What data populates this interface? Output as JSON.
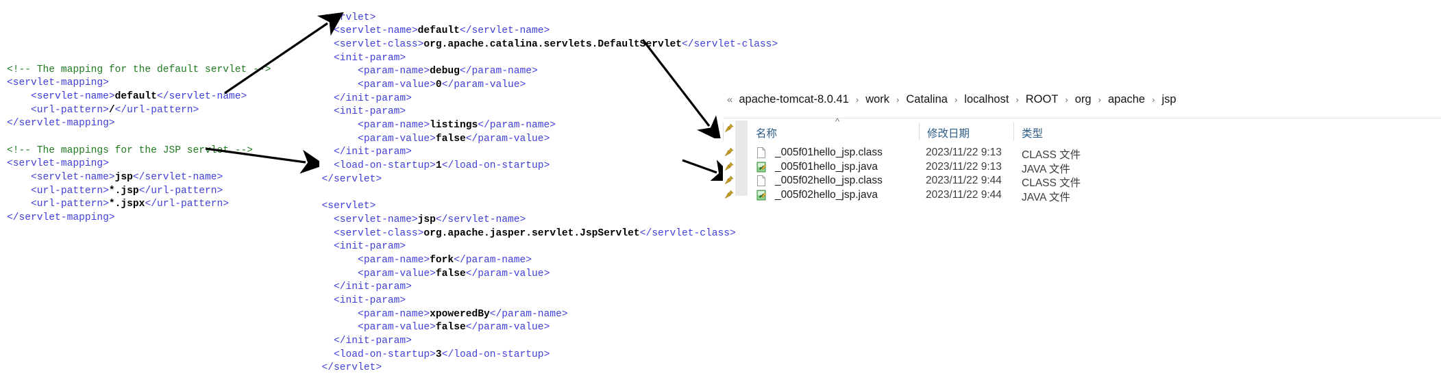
{
  "left_code": {
    "name": "web.xml servlet mappings",
    "lines": [
      [
        {
          "t": "cmt",
          "s": "<!-- The mapping for the default servlet -->"
        }
      ],
      [
        {
          "t": "tag",
          "s": "<servlet-mapping>"
        }
      ],
      [
        {
          "t": "tag",
          "s": "    <servlet-name>"
        },
        {
          "t": "val",
          "s": "default"
        },
        {
          "t": "tag",
          "s": "</servlet-name>"
        }
      ],
      [
        {
          "t": "tag",
          "s": "    <url-pattern>"
        },
        {
          "t": "val",
          "s": "/"
        },
        {
          "t": "tag",
          "s": "</url-pattern>"
        }
      ],
      [
        {
          "t": "tag",
          "s": "</servlet-mapping>"
        }
      ],
      [
        {
          "t": "tag",
          "s": ""
        }
      ],
      [
        {
          "t": "cmt",
          "s": "<!-- The mappings for the JSP servlet -->"
        }
      ],
      [
        {
          "t": "tag",
          "s": "<servlet-mapping>"
        }
      ],
      [
        {
          "t": "tag",
          "s": "    <servlet-name>"
        },
        {
          "t": "val",
          "s": "jsp"
        },
        {
          "t": "tag",
          "s": "</servlet-name>"
        }
      ],
      [
        {
          "t": "tag",
          "s": "    <url-pattern>"
        },
        {
          "t": "val",
          "s": "*.jsp"
        },
        {
          "t": "tag",
          "s": "</url-pattern>"
        }
      ],
      [
        {
          "t": "tag",
          "s": "    <url-pattern>"
        },
        {
          "t": "val",
          "s": "*.jspx"
        },
        {
          "t": "tag",
          "s": "</url-pattern>"
        }
      ],
      [
        {
          "t": "tag",
          "s": "</servlet-mapping>"
        }
      ]
    ]
  },
  "mid_code": {
    "name": "web.xml servlet definitions",
    "lines": [
      [
        {
          "t": "tag",
          "s": "  <servlet>"
        }
      ],
      [
        {
          "t": "tag",
          "s": "    <servlet-name>"
        },
        {
          "t": "val",
          "s": "default"
        },
        {
          "t": "tag",
          "s": "</servlet-name>"
        }
      ],
      [
        {
          "t": "tag",
          "s": "    <servlet-class>"
        },
        {
          "t": "val",
          "s": "org.apache.catalina.servlets.DefaultServlet"
        },
        {
          "t": "tag",
          "s": "</servlet-class>"
        }
      ],
      [
        {
          "t": "tag",
          "s": "    <init-param>"
        }
      ],
      [
        {
          "t": "tag",
          "s": "        <param-name>"
        },
        {
          "t": "val",
          "s": "debug"
        },
        {
          "t": "tag",
          "s": "</param-name>"
        }
      ],
      [
        {
          "t": "tag",
          "s": "        <param-value>"
        },
        {
          "t": "val",
          "s": "0"
        },
        {
          "t": "tag",
          "s": "</param-value>"
        }
      ],
      [
        {
          "t": "tag",
          "s": "    </init-param>"
        }
      ],
      [
        {
          "t": "tag",
          "s": "    <init-param>"
        }
      ],
      [
        {
          "t": "tag",
          "s": "        <param-name>"
        },
        {
          "t": "val",
          "s": "listings"
        },
        {
          "t": "tag",
          "s": "</param-name>"
        }
      ],
      [
        {
          "t": "tag",
          "s": "        <param-value>"
        },
        {
          "t": "val",
          "s": "false"
        },
        {
          "t": "tag",
          "s": "</param-value>"
        }
      ],
      [
        {
          "t": "tag",
          "s": "    </init-param>"
        }
      ],
      [
        {
          "t": "tag",
          "s": "    <load-on-startup>"
        },
        {
          "t": "val",
          "s": "1"
        },
        {
          "t": "tag",
          "s": "</load-on-startup>"
        }
      ],
      [
        {
          "t": "tag",
          "s": "  </servlet>"
        }
      ],
      [
        {
          "t": "tag",
          "s": ""
        }
      ],
      [
        {
          "t": "tag",
          "s": "  <servlet>"
        }
      ],
      [
        {
          "t": "tag",
          "s": "    <servlet-name>"
        },
        {
          "t": "val",
          "s": "jsp"
        },
        {
          "t": "tag",
          "s": "</servlet-name>"
        }
      ],
      [
        {
          "t": "tag",
          "s": "    <servlet-class>"
        },
        {
          "t": "val",
          "s": "org.apache.jasper.servlet.JspServlet"
        },
        {
          "t": "tag",
          "s": "</servlet-class>"
        }
      ],
      [
        {
          "t": "tag",
          "s": "    <init-param>"
        }
      ],
      [
        {
          "t": "tag",
          "s": "        <param-name>"
        },
        {
          "t": "val",
          "s": "fork"
        },
        {
          "t": "tag",
          "s": "</param-name>"
        }
      ],
      [
        {
          "t": "tag",
          "s": "        <param-value>"
        },
        {
          "t": "val",
          "s": "false"
        },
        {
          "t": "tag",
          "s": "</param-value>"
        }
      ],
      [
        {
          "t": "tag",
          "s": "    </init-param>"
        }
      ],
      [
        {
          "t": "tag",
          "s": "    <init-param>"
        }
      ],
      [
        {
          "t": "tag",
          "s": "        <param-name>"
        },
        {
          "t": "val",
          "s": "xpoweredBy"
        },
        {
          "t": "tag",
          "s": "</param-name>"
        }
      ],
      [
        {
          "t": "tag",
          "s": "        <param-value>"
        },
        {
          "t": "val",
          "s": "false"
        },
        {
          "t": "tag",
          "s": "</param-value>"
        }
      ],
      [
        {
          "t": "tag",
          "s": "    </init-param>"
        }
      ],
      [
        {
          "t": "tag",
          "s": "    <load-on-startup>"
        },
        {
          "t": "val",
          "s": "3"
        },
        {
          "t": "tag",
          "s": "</load-on-startup>"
        }
      ],
      [
        {
          "t": "tag",
          "s": "  </servlet>"
        }
      ]
    ]
  },
  "explorer": {
    "breadcrumb": {
      "overflow_glyph": "«",
      "crumbs": [
        "apache-tomcat-8.0.41",
        "work",
        "Catalina",
        "localhost",
        "ROOT",
        "org",
        "apache",
        "jsp"
      ],
      "separator": "›"
    },
    "columns": {
      "name": "名称",
      "modified": "修改日期",
      "type": "类型"
    },
    "files": [
      {
        "name": "_005f01hello_jsp.class",
        "modified": "2023/11/22 9:13",
        "type": "CLASS 文件",
        "icon": "class-file-icon"
      },
      {
        "name": "_005f01hello_jsp.java",
        "modified": "2023/11/22 9:13",
        "type": "JAVA 文件",
        "icon": "java-file-icon"
      },
      {
        "name": "_005f02hello_jsp.class",
        "modified": "2023/11/22 9:44",
        "type": "CLASS 文件",
        "icon": "class-file-icon"
      },
      {
        "name": "_005f02hello_jsp.java",
        "modified": "2023/11/22 9:44",
        "type": "JAVA 文件",
        "icon": "java-file-icon"
      }
    ]
  },
  "colors": {
    "tag": "#3f3fd8",
    "comment": "#1f7a1f",
    "value": "#000000",
    "arrow": "#000000",
    "column_header": "#2d5c88"
  }
}
